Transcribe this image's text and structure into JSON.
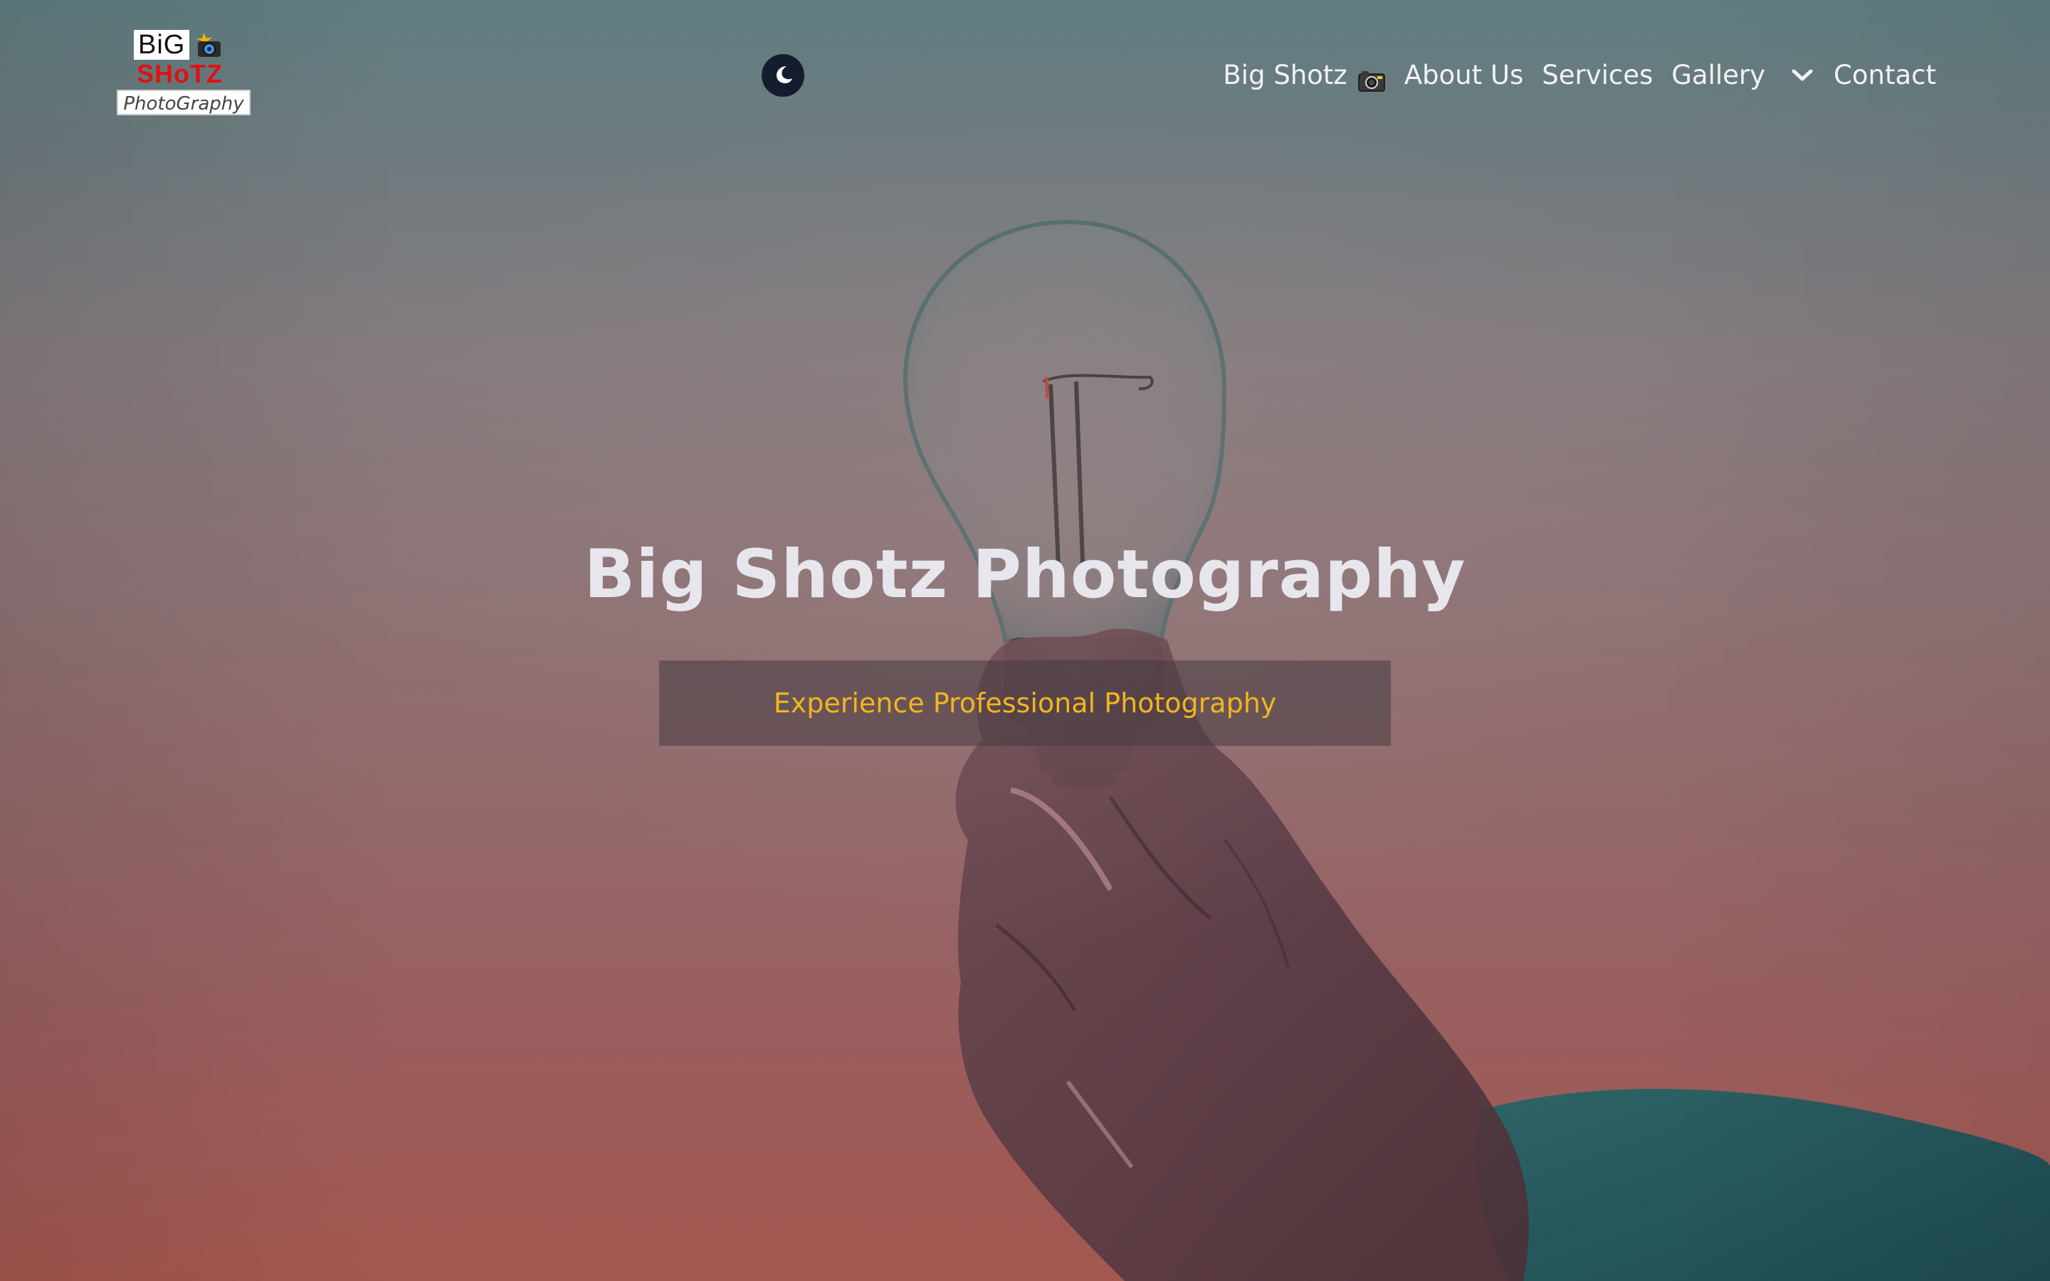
{
  "logo": {
    "line1": "BiG",
    "line2": "SHoTZ",
    "line3": "PhotoGraphy",
    "camera_icon": "camera-flash-icon"
  },
  "theme_toggle": {
    "icon": "moon-icon"
  },
  "nav": {
    "items": [
      {
        "label": "Big Shotz",
        "icon": "camera-icon"
      },
      {
        "label": "About Us"
      },
      {
        "label": "Services"
      },
      {
        "label": "Gallery",
        "icon": "chevron-down-icon"
      },
      {
        "label": "Contact"
      }
    ]
  },
  "hero": {
    "title": "Big Shotz Photography",
    "subtitle": "Experience Professional Photography"
  },
  "colors": {
    "accent": "#f2b51e",
    "toggle_bg": "#151c2e",
    "logo_red": "#e01212"
  }
}
